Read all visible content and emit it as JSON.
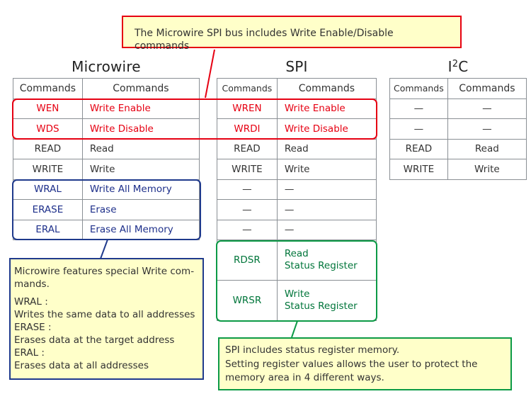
{
  "callouts": {
    "top": "The Microwire SPI bus includes Write Enable/Disable commands",
    "microwire": {
      "intro": "Microwire features special Write com-mands.",
      "intro_line1": "Microwire features special Write com-",
      "intro_line2": "mands.",
      "items": [
        {
          "term": "WRAL :",
          "desc": "Writes the same data to all addresses"
        },
        {
          "term": "ERASE :",
          "desc": "Erases data at the target address"
        },
        {
          "term": "ERAL :",
          "desc": "Erases data at all addresses"
        }
      ]
    },
    "spi": {
      "line1": "SPI includes status register memory.",
      "line2": "Setting register values allows the user to protect the",
      "line3": "memory area in 4 different ways."
    }
  },
  "colors": {
    "write_enable_highlight": "#e60012",
    "microwire_special_highlight": "#1f3a8c",
    "spi_status_highlight": "#0c9a46",
    "callout_fill": "#ffffc9"
  },
  "tables": {
    "microwire": {
      "title": "Microwire",
      "headers": [
        "Commands",
        "Commands"
      ],
      "rows": [
        {
          "cmd": "WEN",
          "desc": "Write Enable",
          "group": "red"
        },
        {
          "cmd": "WDS",
          "desc": "Write Disable",
          "group": "red"
        },
        {
          "cmd": "READ",
          "desc": "Read",
          "group": ""
        },
        {
          "cmd": "WRITE",
          "desc": "Write",
          "group": ""
        },
        {
          "cmd": "WRAL",
          "desc": "Write All Memory",
          "group": "blue"
        },
        {
          "cmd": "ERASE",
          "desc": "Erase",
          "group": "blue"
        },
        {
          "cmd": "ERAL",
          "desc": "Erase All Memory",
          "group": "blue"
        }
      ]
    },
    "spi": {
      "title": "SPI",
      "headers": [
        "Commands",
        "Commands"
      ],
      "rows": [
        {
          "cmd": "WREN",
          "desc": "Write Enable",
          "group": "red"
        },
        {
          "cmd": "WRDI",
          "desc": "Write Disable",
          "group": "red"
        },
        {
          "cmd": "READ",
          "desc": "Read",
          "group": ""
        },
        {
          "cmd": "WRITE",
          "desc": "Write",
          "group": ""
        },
        {
          "cmd": "—",
          "desc": "—",
          "group": ""
        },
        {
          "cmd": "—",
          "desc": "—",
          "group": ""
        },
        {
          "cmd": "—",
          "desc": "—",
          "group": ""
        },
        {
          "cmd": "RDSR",
          "desc_line1": "Read",
          "desc_line2": "Status Register",
          "group": "green"
        },
        {
          "cmd": "WRSR",
          "desc_line1": "Write",
          "desc_line2": "Status Register",
          "group": "green"
        }
      ]
    },
    "i2c": {
      "title_main": "I",
      "title_sup": "2",
      "title_end": "C",
      "headers": [
        "Commands",
        "Commands"
      ],
      "rows": [
        {
          "cmd": "—",
          "desc": "—"
        },
        {
          "cmd": "—",
          "desc": "—"
        },
        {
          "cmd": "READ",
          "desc": "Read"
        },
        {
          "cmd": "WRITE",
          "desc": "Write"
        }
      ]
    }
  }
}
